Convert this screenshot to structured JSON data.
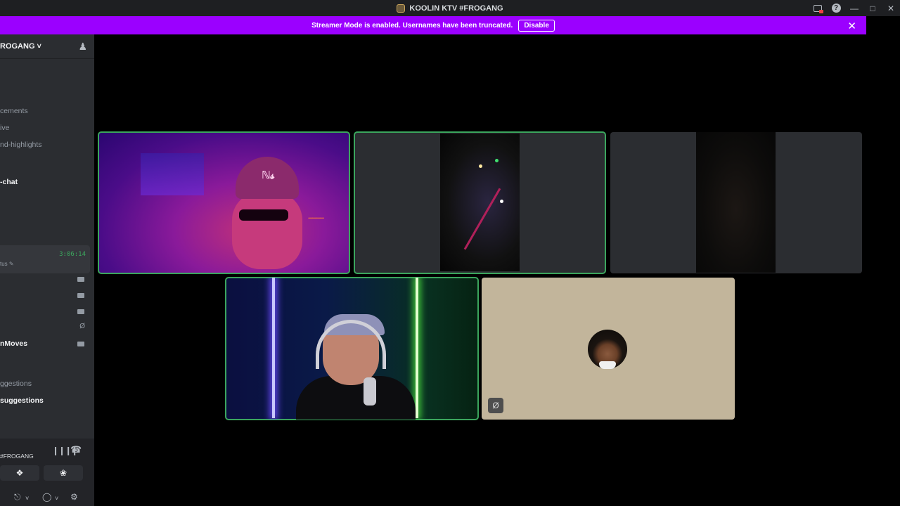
{
  "window": {
    "title": "KOOLIN KTV #FROGANG",
    "controls": [
      "screen-share-icon",
      "help-icon",
      "minimize-icon",
      "maximize-icon",
      "close-icon"
    ]
  },
  "banner": {
    "message": "Streamer Mode is enabled. Usernames have been truncated.",
    "disable_label": "Disable",
    "color": "#9b00ff"
  },
  "sidebar": {
    "server_name": "ROGANG",
    "channels": [
      {
        "label": "cements"
      },
      {
        "label": "ive"
      },
      {
        "label": "nd-highlights"
      },
      {
        "label": "-chat"
      }
    ],
    "voice": {
      "timer": "3:06:14",
      "status": "tus"
    },
    "member": "nMoves",
    "channels_lower": [
      {
        "label": "ggestions"
      },
      {
        "label": "suggestions"
      }
    ]
  },
  "panel": {
    "voice_channel": "#FROGANG"
  },
  "accent": {
    "speaking": "#3ba55d",
    "timer": "#3ba55d"
  }
}
